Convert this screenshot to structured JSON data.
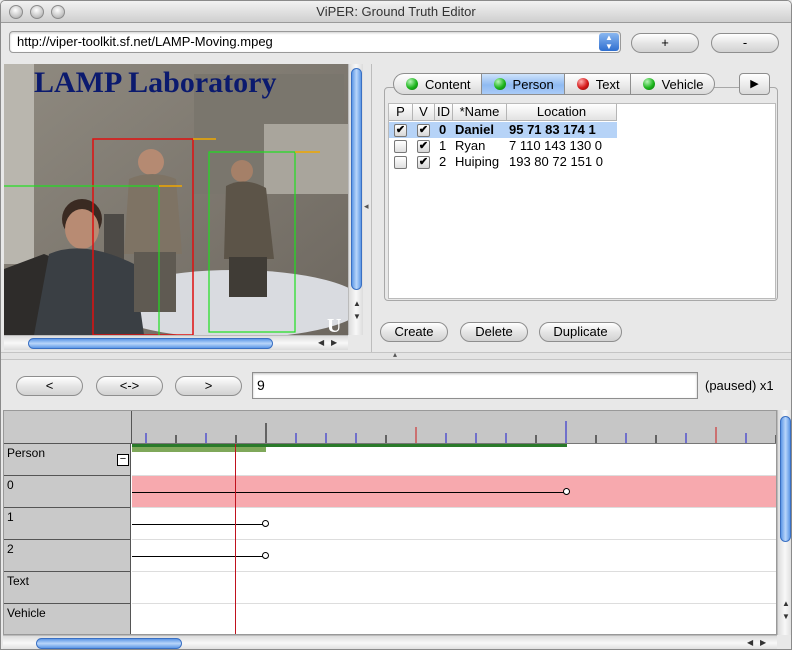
{
  "window": {
    "title": "ViPER: Ground Truth Editor"
  },
  "url_bar": {
    "value": "http://viper-toolkit.sf.net/LAMP-Moving.mpeg",
    "add_label": "+",
    "remove_label": "-"
  },
  "video": {
    "overlay_title": "LAMP Laboratory",
    "corner_text": "U"
  },
  "tabs": [
    {
      "label": "Content",
      "color": "#1cb51c"
    },
    {
      "label": "Person",
      "color": "#1cb51c",
      "selected": true
    },
    {
      "label": "Text",
      "color": "#d51a1a"
    },
    {
      "label": "Vehicle",
      "color": "#1cb51c"
    }
  ],
  "tab_more": "▶",
  "table": {
    "columns": [
      "P",
      "V",
      "ID",
      "*Name",
      "Location"
    ],
    "rows": [
      {
        "p": true,
        "v": true,
        "id": "0",
        "name": "Daniel",
        "location": "95 71 83 174 1",
        "selected": true
      },
      {
        "p": false,
        "v": true,
        "id": "1",
        "name": "Ryan",
        "location": "7 110 143 130 0"
      },
      {
        "p": false,
        "v": true,
        "id": "2",
        "name": "Huiping",
        "location": "193 80 72 151 0"
      }
    ]
  },
  "actions": {
    "create": "Create",
    "delete": "Delete",
    "duplicate": "Duplicate"
  },
  "playback": {
    "prev": "<",
    "both": "<->",
    "next": ">",
    "frame": "9",
    "status": "(paused) x1"
  },
  "timeline": {
    "tracks": [
      "Person",
      "0",
      "1",
      "2",
      "Text",
      "Vehicle"
    ],
    "collapse_symbol": "−"
  }
}
